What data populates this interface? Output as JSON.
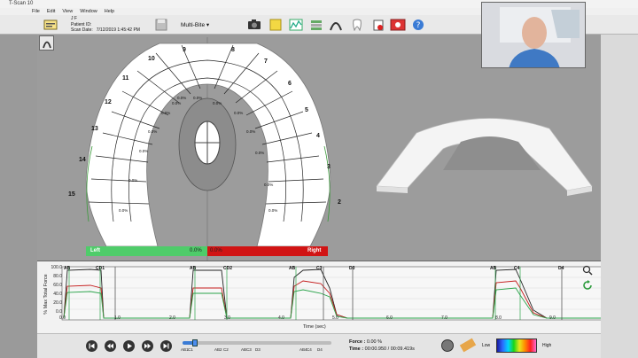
{
  "window": {
    "title": "T-Scan 10"
  },
  "menu": [
    "File",
    "Edit",
    "View",
    "Window",
    "Help"
  ],
  "patient": {
    "name": "J F",
    "id_label": "Patient ID:",
    "scan_date_label": "Scan Date:",
    "scan_date": "7/12/2019 1:45:42 PM"
  },
  "toolbar": {
    "view_select": "Multi-Bite"
  },
  "arch": {
    "tooth_numbers": [
      "15",
      "14",
      "13",
      "12",
      "11",
      "10",
      "9",
      "8",
      "7",
      "6",
      "5",
      "4",
      "3",
      "2"
    ],
    "percent_label": "0.0%"
  },
  "balance": {
    "left_label": "Left",
    "left_value": "0.0%",
    "right_label": "Right",
    "right_value": "0.0%"
  },
  "graph": {
    "y_axis_label": "% Max Total Force",
    "x_axis_label": "Time (sec)",
    "y_ticks": [
      "100.0",
      "80.0",
      "60.0",
      "40.0",
      "20.0",
      "0.0"
    ],
    "x_ticks": [
      "0.0",
      "1.0",
      "2.0",
      "3.0",
      "4.0",
      "5.0",
      "6.0",
      "7.0",
      "8.0",
      "9.0"
    ],
    "markers": [
      "A",
      "B",
      "C",
      "D1",
      "A",
      "B",
      "C",
      "D2",
      "A",
      "B",
      "C",
      "D3",
      "A",
      "B",
      "C",
      "D4",
      "A",
      "B",
      "C",
      "D",
      "C3",
      "C4"
    ]
  },
  "playback": {
    "force_label": "Force :",
    "force_value": "0.00 %",
    "time_label": "Time :",
    "time_value": "00:00.950 / 00:09.419s",
    "scale_low": "Low",
    "scale_high": "High",
    "timeline_labels": [
      "AB1",
      "C1",
      "AB2",
      "C2",
      "ABC3",
      "D3",
      "AB4",
      "C4",
      "D4"
    ]
  },
  "colors": {
    "left_bar": "#4fcc6a",
    "right_bar": "#d11414",
    "force_line": "#222222",
    "left_line": "#2aa34a",
    "right_line": "#c41a1a"
  }
}
